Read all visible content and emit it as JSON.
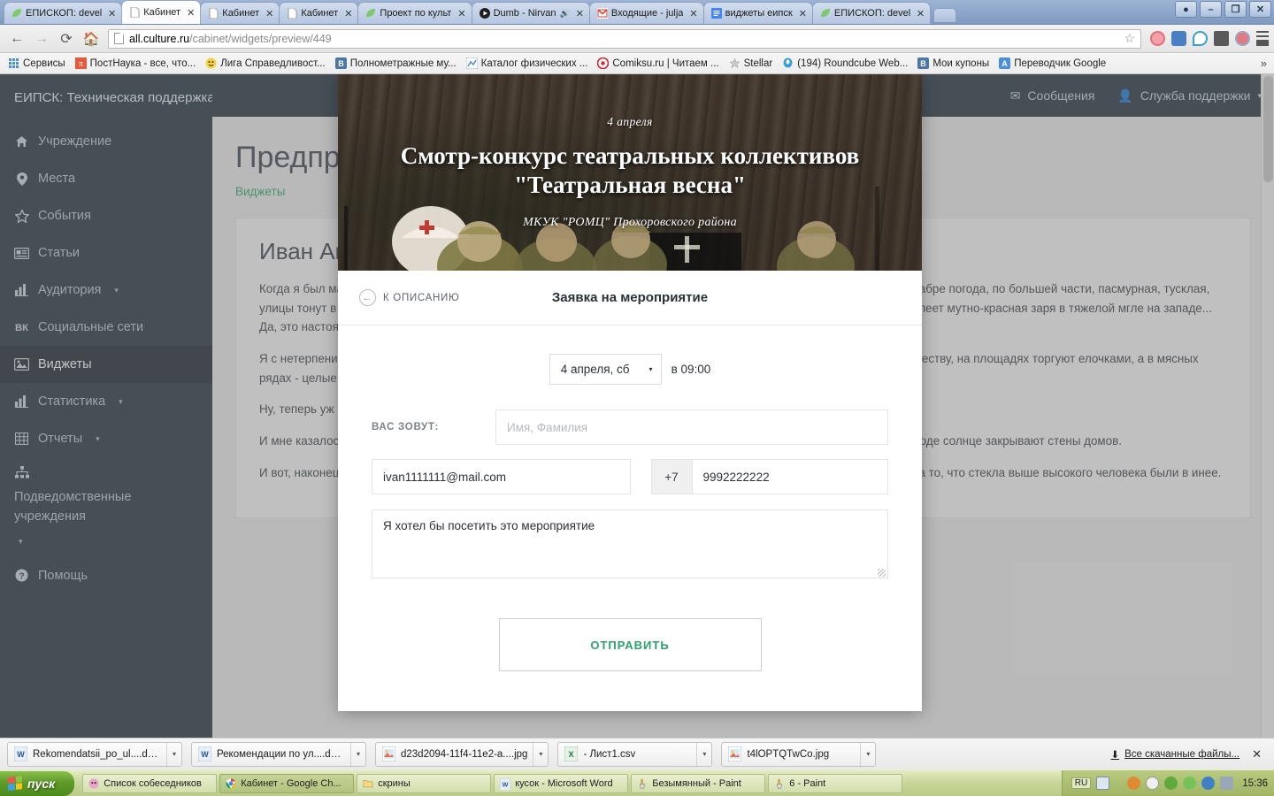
{
  "browser": {
    "tabs": [
      {
        "label": "ЕПИСКОП: devel",
        "icon": "leaf-icon",
        "active": false
      },
      {
        "label": "Кабинет",
        "icon": "page-icon",
        "active": true
      },
      {
        "label": "Кабинет",
        "icon": "page-icon",
        "active": false
      },
      {
        "label": "Кабинет",
        "icon": "page-icon",
        "active": false
      },
      {
        "label": "Проект по культ",
        "icon": "leaf-icon",
        "active": false
      },
      {
        "label": "Dumb - Nirvan",
        "icon": "play-icon",
        "active": false,
        "audio": true
      },
      {
        "label": "Входящие - julja",
        "icon": "gmail-icon",
        "active": false
      },
      {
        "label": "виджеты еипск",
        "icon": "doc-icon",
        "active": false
      },
      {
        "label": "ЕПИСКОП: devel",
        "icon": "leaf-icon",
        "active": false
      }
    ],
    "tab_close_label": "✕",
    "window_controls": [
      {
        "name": "user-button",
        "glyph": "●"
      },
      {
        "name": "minimize-button",
        "glyph": "–"
      },
      {
        "name": "maximize-button",
        "glyph": "❐"
      },
      {
        "name": "close-button",
        "glyph": "✕"
      }
    ],
    "nav": {
      "back": "←",
      "forward": "→",
      "reload": "⟳",
      "home": "⌂"
    },
    "url_prefix": "all.culture.ru",
    "url_suffix": "/cabinet/widgets/preview/449",
    "star": "☆",
    "toolbar_icons": [
      "camera-icon",
      "speaker-icon",
      "drop-icon",
      "mail-icon",
      "clock-icon",
      "menu-icon"
    ],
    "bookmarks": [
      {
        "label": "Сервисы",
        "icon": "apps-icon"
      },
      {
        "label": "ПостНаука - все, что...",
        "icon": "postnauka-icon"
      },
      {
        "label": "Лига Справедливост...",
        "icon": "smiley-icon"
      },
      {
        "label": "Полнометражные му...",
        "icon": "vk-icon"
      },
      {
        "label": "Каталог физических ...",
        "icon": "chart-icon"
      },
      {
        "label": "Comiksu.ru | Читаем ...",
        "icon": "target-icon"
      },
      {
        "label": "Stellar",
        "icon": "star-icon"
      },
      {
        "label": "(194) Roundcube Web...",
        "icon": "roundcube-icon"
      },
      {
        "label": "Мои купоны",
        "icon": "vk-icon"
      },
      {
        "label": "Переводчик Google",
        "icon": "translate-icon"
      }
    ],
    "bookmarks_overflow": "»"
  },
  "app": {
    "brand": "ЕИПСК: Техническая поддержка",
    "topbar": [
      {
        "label": "Сообщения",
        "icon": "envelope-icon",
        "caret": false
      },
      {
        "label": "Служба поддержки",
        "icon": "user-icon",
        "caret": true
      }
    ],
    "topbar_caret": "▾",
    "sidebar": [
      {
        "label": "Учреждение",
        "icon": "home-icon",
        "caret": false,
        "active": false
      },
      {
        "label": "Места",
        "icon": "pin-icon",
        "caret": false,
        "active": false
      },
      {
        "label": "События",
        "icon": "star-icon",
        "caret": false,
        "active": false
      },
      {
        "label": "Статьи",
        "icon": "news-icon",
        "caret": false,
        "active": false
      },
      {
        "label": "Аудитория",
        "icon": "bars-icon",
        "caret": true,
        "active": false
      },
      {
        "label": "Социальные сети",
        "icon": "vk-icon",
        "caret": false,
        "active": false
      },
      {
        "label": "Виджеты",
        "icon": "image-icon",
        "caret": false,
        "active": true
      },
      {
        "label": "Статистика",
        "icon": "bars-icon",
        "caret": true,
        "active": false
      },
      {
        "label": "Отчеты",
        "icon": "table-icon",
        "caret": true,
        "active": false
      },
      {
        "label": "Подведомственные учреждения",
        "icon": "sitemap-icon",
        "caret": true,
        "active": false
      },
      {
        "label": "Помощь",
        "icon": "question-icon",
        "caret": false,
        "active": false
      }
    ],
    "sidebar_caret": "▾",
    "page": {
      "title": "Предпросмотр",
      "breadcrumb": "Виджеты",
      "article_title": "Иван Андреев",
      "paragraphs": [
        "Когда я был маленьким, мне казалось, что самое лучшее время года - весна. \"Декабрь - вот это зима\", - думал я. В декабре погода, по большей части, пасмурная, тусклая, улицы тонут в тумане, а деревья одеты густым инеем сиреневого цвета: солнца почти не видно, только к вечеру чуть алеет мутно-красная заря в тяжелой мгле на западе... Да, это настоящая зима.",
        "Я с нетерпением ждал праздников: витрины магазинов полны блестящих игрушек и украшений, приготовленных к Рождеству, на площадях торгуют елочками, а в мясных рядах - целые горы мерзлых свиных туш и птицы.",
        "Ну, теперь уж близко, совсем близко! Через две недели уеду в деревню и буду там встречать начало весны.",
        "И мне казалось, что в деревне весна особенная: там бывают настоящие светлые, солнечные дни. И правда, ведь в городе солнце закрывают стены домов.",
        "И вот, наконец, весна приходила. Выбегая из нашей квартиры, я стремглав бежал в прихожую и наталкивался только на то, что стекла выше высокого человека были в инее."
      ]
    }
  },
  "modal": {
    "banner": {
      "date": "4 апреля",
      "title": "Смотр-конкурс театральных коллективов \"Театральная весна\"",
      "organization": "МКУК \"РОМЦ\" Прохоровского района"
    },
    "back_label": "К ОПИСАНИЮ",
    "back_arrow": "←",
    "title": "Заявка на мероприятие",
    "date_select": {
      "value": "4 апреля, сб",
      "caret": "▾",
      "time_text": "в 09:00"
    },
    "name_label": "ВАС ЗОВУТ:",
    "name_placeholder": "Имя, Фамилия",
    "name_value": "",
    "email_value": "ivan1111111@mail.com",
    "phone_code": "+7",
    "phone_value": "9992222222",
    "message_value": "Я хотел бы посетить это мероприятие",
    "submit_label": "ОТПРАВИТЬ"
  },
  "downloads": {
    "items": [
      {
        "name": "Rekomendatsii_po_ul....docx",
        "icon": "word-icon"
      },
      {
        "name": "Рекомендации по ул....docx",
        "icon": "word-icon"
      },
      {
        "name": "d23d2094-11f4-11e2-a....jpg",
        "icon": "image-icon"
      },
      {
        "name": "- Лист1.csv",
        "icon": "excel-icon"
      },
      {
        "name": "t4lOPTQTwCo.jpg",
        "icon": "image-icon"
      }
    ],
    "caret": "▾",
    "all_label": "Все скачанные файлы...",
    "all_icon": "⬇",
    "close_label": "✕"
  },
  "taskbar": {
    "start_label": "пуск",
    "tasks": [
      {
        "label": "Список собеседников",
        "icon": "im-icon",
        "active": false
      },
      {
        "label": "Кабинет - Google Ch...",
        "icon": "chrome-icon",
        "active": true
      },
      {
        "label": "скрины",
        "icon": "folder-icon",
        "active": false
      },
      {
        "label": "кусок - Microsoft Word",
        "icon": "word-icon",
        "active": false
      },
      {
        "label": "Безымянный - Paint",
        "icon": "paint-icon",
        "active": false
      },
      {
        "label": "6 - Paint",
        "icon": "paint-icon",
        "active": false
      }
    ],
    "lang": "RU",
    "tray_icons": [
      "help-icon",
      "arrow-icon",
      "shield-icon",
      "bell-icon",
      "network-icon",
      "battery-icon",
      "update-icon",
      "monitor-icon"
    ],
    "clock": "15:36"
  },
  "colors": {
    "sidebar_bg": "#23313f",
    "sidebar_active": "#1a252f",
    "accent_green": "#2aa26a",
    "modal_bg": "#ffffff"
  }
}
